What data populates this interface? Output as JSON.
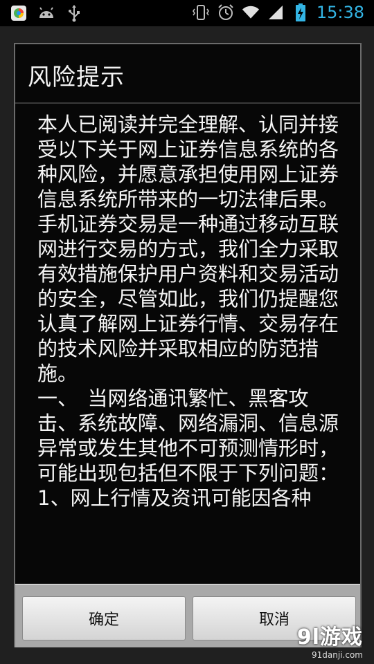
{
  "status_bar": {
    "time": "15:38",
    "left_icons": [
      "app-icon",
      "android-icon",
      "usb-icon"
    ],
    "right_icons": [
      "vibrate-icon",
      "alarm-icon",
      "wifi-icon",
      "signal-icon",
      "battery-icon"
    ],
    "accent_color": "#33b5e5"
  },
  "dialog": {
    "title": "风险提示",
    "message": "本人已阅读并完全理解、认同并接受以下关于网上证券信息系统的各种风险，并愿意承担使用网上证券信息系统所带来的一切法律后果。\n手机证券交易是一种通过移动互联网进行交易的方式，我们全力采取有效措施保护用户资料和交易活动的安全，尽管如此，我们仍提醒您认真了解网上证券行情、交易存在的技术风险并采取相应的防范措施。\n一、　当网络通讯繁忙、黑客攻击、系统故障、网络漏洞、信息源异常或发生其他不可预测情形时，可能出现包括但不限于下列问题：\n1、网上行情及资讯可能因各种",
    "buttons": {
      "ok": "确定",
      "cancel": "取消"
    }
  },
  "watermark": {
    "logo": "9l游戏",
    "url": "91danji.com"
  }
}
